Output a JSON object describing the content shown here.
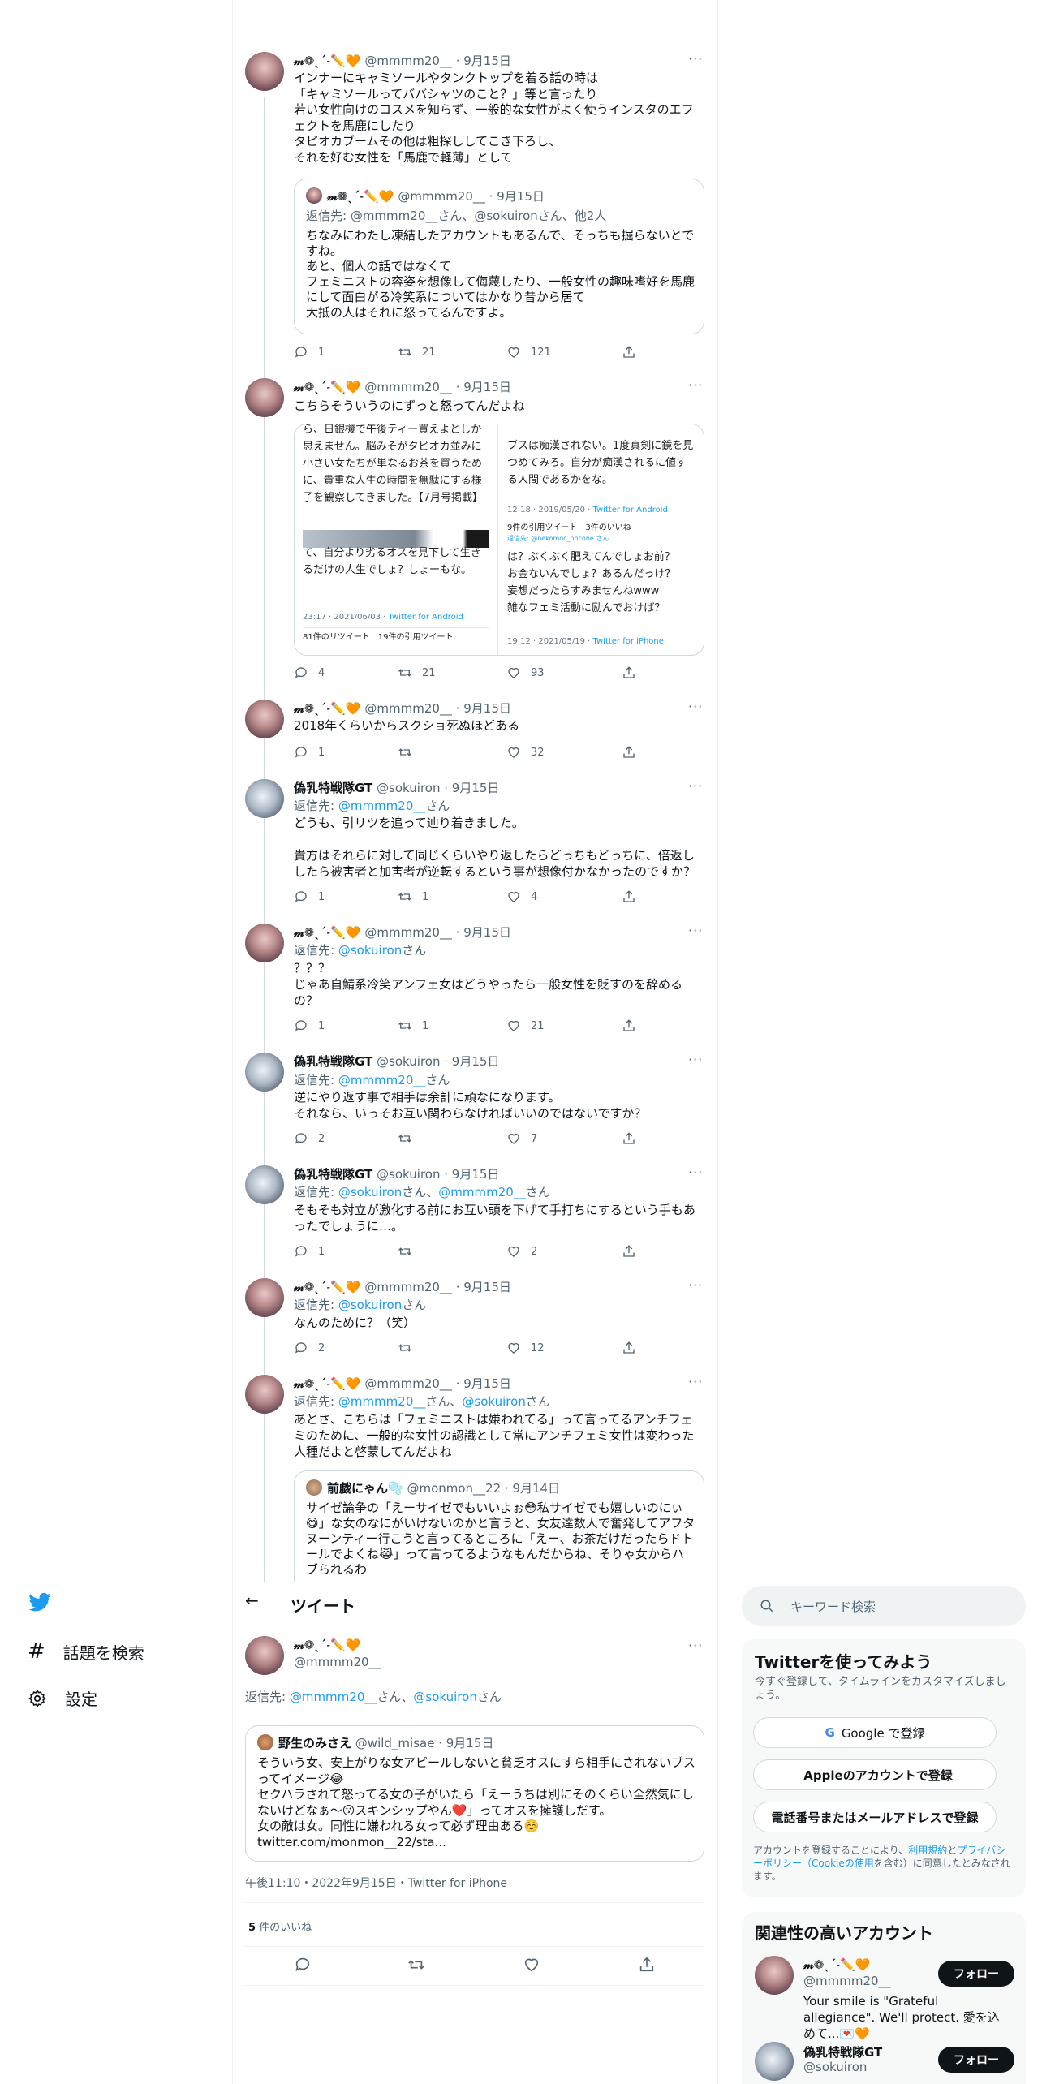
{
  "user_m": {
    "name": "𝓂❁ˎˊ˗✏️🧡",
    "handle": "@mmmm20__"
  },
  "user_s": {
    "name": "偽乳特戦隊GT",
    "handle": "@sokuiron"
  },
  "date_sep15": "· 9月15日",
  "more": "···",
  "reply_prefix": "返信先: ",
  "san": "さん",
  "tweets": [
    {
      "body": "インナーにキャミソールやタンクトップを着る話の時は\n「キャミソールってババシャツのこと？」等と言ったり\n若い女性向けのコスメを知らず、一般的な女性がよく使うインスタのエフェクトを馬鹿にしたり\nタピオカブームその他は粗探ししてこき下ろし、\nそれを好む女性を「馬鹿で軽薄」として",
      "quote": {
        "reply": "返信先: @mmmm20__さん、@sokuironさん、他2人",
        "text": "ちなみにわたし凍結したアカウントもあるんで、そっちも掘らないとですね。\nあと、個人の話ではなくて\nフェミニストの容姿を想像して侮蔑したり、一般女性の趣味嗜好を馬鹿にして面白がる冷笑系についてはかなり昔から居て\n大抵の人はそれに怒ってるんですよ。"
      },
      "reply_count": "1",
      "retweets": "21",
      "likes": "121"
    },
    {
      "body": "こちらそういうのにずっと怒ってんだよね",
      "shot_left_top": "ら、日銀機で午後ティー買えよとしか思えません。脳みそがタピオカ並みに小さい女たちが単なるお茶を買うために、貴重な人生の時間を無駄にする様子を観察してきました。【7月号掲載】",
      "shot_left_bottom": "て、自分より劣るオスを見下して生きるだけの人生でしょ？しょーもな。",
      "shot_left_meta": "23:17 · 2021/06/03 · ",
      "shot_left_client": "Twitter for Android",
      "shot_left_stats": "81件のリツイート　19件の引用ツイート",
      "shot_right_top": "ブスは痴漢されない。1度真剣に鏡を見つめてみろ。自分が痴漢されるに値する人間であるかをな。",
      "shot_right_meta": "12:18 · 2019/05/20 · ",
      "shot_right_client": "Twitter for Android",
      "shot_right_stats": "9件の引用ツイート　3件のいいね",
      "shot_right_reply": "返信先: @nekomoc_nocone さん",
      "shot_right_mid": "は？ぶくぶく肥えてんでしょお前？\nお金ないんでしょ？あるんだっけ？\n妄想だったらすみませんねwww\n雑なフェミ活動に励んでおけば？",
      "shot_right_meta2": "19:12 · 2021/05/19 · ",
      "shot_right_client2": "Twitter for iPhone",
      "reply_count": "4",
      "retweets": "21",
      "likes": "93"
    },
    {
      "body": "2018年くらいからスクショ死ぬほどある",
      "reply_count": "1",
      "retweets": "",
      "likes": "32"
    },
    {
      "reply_to": "@mmmm20__",
      "body": "どうも、引リツを追って辿り着きました。\n\n貴方はそれらに対して同じくらいやり返したらどっちもどっちに、倍返ししたら被害者と加害者が逆転するという事が想像付かなかったのですか？",
      "reply_count": "1",
      "retweets": "1",
      "likes": "4"
    },
    {
      "reply_to": "@sokuiron",
      "body": "？？？\nじゃあ自鯖系冷笑アンフェ女はどうやったら一般女性を貶すのを辞めるの？",
      "reply_count": "1",
      "retweets": "1",
      "likes": "21"
    },
    {
      "reply_to": "@mmmm20__",
      "body": "逆にやり返す事で相手は余計に頑なになります。\nそれなら、いっそお互い関わらなければいいのではないですか？",
      "reply_count": "2",
      "retweets": "",
      "likes": "7"
    },
    {
      "reply_to": "@sokuiron",
      "reply_to2": "@mmmm20__",
      "body": "そもそも対立が激化する前にお互い頭を下げて手打ちにするという手もあったでしょうに…。",
      "reply_count": "1",
      "retweets": "",
      "likes": "2"
    },
    {
      "reply_to": "@sokuiron",
      "body": "なんのために？（笑）",
      "reply_count": "2",
      "retweets": "",
      "likes": "12"
    },
    {
      "reply_to": "@mmmm20__",
      "reply_to2": "@sokuiron",
      "body": "あとさ、こちらは「フェミニストは嫌われてる」って言ってるアンチフェミのために、一般的な女性の認識として常にアンチフェミ女性は変わった人種だよと啓蒙してんだよね",
      "quote": {
        "name": "前戯にゃん🫧",
        "handle": "@monmon__22",
        "date": "· 9月14日",
        "text": "サイゼ論争の「えーサイゼでもいいよぉ😳私サイゼでも嬉しいのにぃ😋」な女のなにがいけないのかと言うと、女友達数人で奮発してアフタヌーンティー行こうと言ってるところに「えー、お茶だけだったらドトールでよくね😹」って言ってるようなもんだからね、そりゃ女からハブられるわ"
      }
    }
  ],
  "main_tweet": {
    "reply_to": "@mmmm20__",
    "reply_to2": "@sokuiron",
    "quote": {
      "name": "野生のみさえ",
      "handle": "@wild_misae",
      "date": "· 9月15日",
      "text": "そういう女、安上がりな女アピールしないと貧乏オスにすら相手にされないブスってイメージ😂\nセクハラされて怒ってる女の子がいたら「えーうちは別にそのくらい全然気にしないけどなぁ〜😗スキンシップやん❤️」ってオスを擁護しだす。\n女の敵は女。同性に嫌われる女って必ず理由ある☺️\ntwitter.com/monmon__22/sta..."
    },
    "timestamp": "午後11:10・2022年9月15日・Twitter for iPhone",
    "likes_num": "5",
    "likes_label": " 件のいいね"
  },
  "nav": {
    "back": "←",
    "title": "ツイート"
  },
  "sidebar": {
    "explore": "話題を検索",
    "settings": "設定"
  },
  "search": {
    "placeholder": "キーワード検索"
  },
  "signup": {
    "title": "Twitterを使ってみよう",
    "subtitle": "今すぐ登録して、タイムラインをカスタマイズしましょう。",
    "google": "Google で登録",
    "apple": "Appleのアカウントで登録",
    "phone": "電話番号またはメールアドレスで登録",
    "terms_a": "アカウントを登録することにより、",
    "terms_link1": "利用規約",
    "terms_b": "と",
    "terms_link2": "プライバシーポリシー（Cookieの使用",
    "terms_c": "を含む）に同意したとみなされます。"
  },
  "related": {
    "title": "関連性の高いアカウント",
    "follow": "フォロー",
    "m_bio": "Your smile is \"Grateful allegiance\". We'll protect. 愛を込めて...💌🧡"
  },
  "colors": {
    "accent": "#1d9bf0",
    "text": "#0f1419",
    "muted": "#536471",
    "border": "#cfd9de"
  }
}
